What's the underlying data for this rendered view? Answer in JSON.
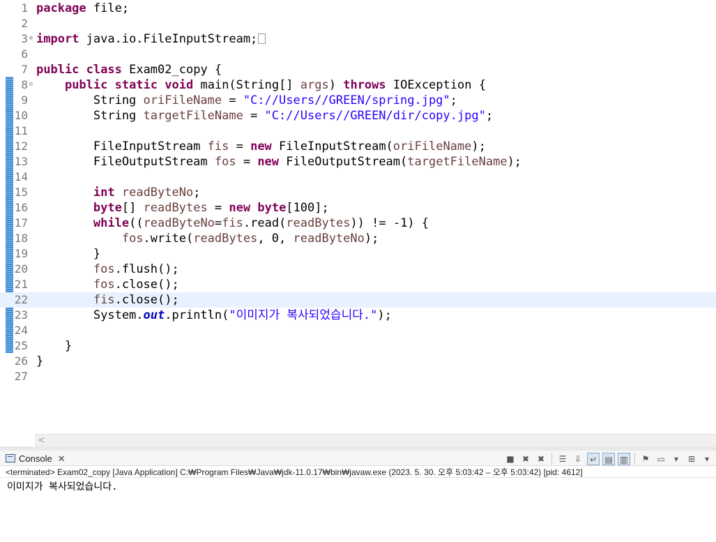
{
  "editor": {
    "file_lines": [
      {
        "n": "1",
        "tokens": [
          {
            "t": "kw",
            "v": "package"
          },
          {
            "t": "",
            "v": " file;"
          }
        ]
      },
      {
        "n": "2",
        "tokens": []
      },
      {
        "n": "3",
        "fold": "plus",
        "tokens": [
          {
            "t": "kw",
            "v": "import"
          },
          {
            "t": "",
            "v": " java.io.FileInputStream;"
          },
          {
            "t": "box",
            "v": ""
          }
        ]
      },
      {
        "n": "6",
        "tokens": []
      },
      {
        "n": "7",
        "tokens": [
          {
            "t": "kw",
            "v": "public"
          },
          {
            "t": "",
            "v": " "
          },
          {
            "t": "kw",
            "v": "class"
          },
          {
            "t": "",
            "v": " Exam02_copy {"
          }
        ]
      },
      {
        "n": "8",
        "fold": "minus",
        "tokens": [
          {
            "t": "",
            "v": "    "
          },
          {
            "t": "kw",
            "v": "public"
          },
          {
            "t": "",
            "v": " "
          },
          {
            "t": "kw",
            "v": "static"
          },
          {
            "t": "",
            "v": " "
          },
          {
            "t": "kw",
            "v": "void"
          },
          {
            "t": "",
            "v": " main(String[] "
          },
          {
            "t": "var",
            "v": "args"
          },
          {
            "t": "",
            "v": ") "
          },
          {
            "t": "kw",
            "v": "throws"
          },
          {
            "t": "",
            "v": " IOException {"
          }
        ]
      },
      {
        "n": "9",
        "tokens": [
          {
            "t": "",
            "v": "        String "
          },
          {
            "t": "var",
            "v": "oriFileName"
          },
          {
            "t": "",
            "v": " = "
          },
          {
            "t": "str",
            "v": "\"C://Users//GREEN/spring.jpg\""
          },
          {
            "t": "",
            "v": ";"
          }
        ]
      },
      {
        "n": "10",
        "tokens": [
          {
            "t": "",
            "v": "        String "
          },
          {
            "t": "var",
            "v": "targetFileName"
          },
          {
            "t": "",
            "v": " = "
          },
          {
            "t": "str",
            "v": "\"C://Users//GREEN/dir/copy.jpg\""
          },
          {
            "t": "",
            "v": ";"
          }
        ]
      },
      {
        "n": "11",
        "tokens": []
      },
      {
        "n": "12",
        "tokens": [
          {
            "t": "",
            "v": "        FileInputStream "
          },
          {
            "t": "var",
            "v": "fis"
          },
          {
            "t": "",
            "v": " = "
          },
          {
            "t": "kw",
            "v": "new"
          },
          {
            "t": "",
            "v": " FileInputStream("
          },
          {
            "t": "var",
            "v": "oriFileName"
          },
          {
            "t": "",
            "v": ");"
          }
        ]
      },
      {
        "n": "13",
        "tokens": [
          {
            "t": "",
            "v": "        FileOutputStream "
          },
          {
            "t": "var",
            "v": "fos"
          },
          {
            "t": "",
            "v": " = "
          },
          {
            "t": "kw",
            "v": "new"
          },
          {
            "t": "",
            "v": " FileOutputStream("
          },
          {
            "t": "var",
            "v": "targetFileName"
          },
          {
            "t": "",
            "v": ");"
          }
        ]
      },
      {
        "n": "14",
        "tokens": []
      },
      {
        "n": "15",
        "tokens": [
          {
            "t": "",
            "v": "        "
          },
          {
            "t": "kw",
            "v": "int"
          },
          {
            "t": "",
            "v": " "
          },
          {
            "t": "var",
            "v": "readByteNo"
          },
          {
            "t": "",
            "v": ";"
          }
        ]
      },
      {
        "n": "16",
        "tokens": [
          {
            "t": "",
            "v": "        "
          },
          {
            "t": "kw",
            "v": "byte"
          },
          {
            "t": "",
            "v": "[] "
          },
          {
            "t": "var",
            "v": "readBytes"
          },
          {
            "t": "",
            "v": " = "
          },
          {
            "t": "kw",
            "v": "new"
          },
          {
            "t": "",
            "v": " "
          },
          {
            "t": "kw",
            "v": "byte"
          },
          {
            "t": "",
            "v": "[100];"
          }
        ]
      },
      {
        "n": "17",
        "tokens": [
          {
            "t": "",
            "v": "        "
          },
          {
            "t": "kw",
            "v": "while"
          },
          {
            "t": "",
            "v": "(("
          },
          {
            "t": "var",
            "v": "readByteNo"
          },
          {
            "t": "",
            "v": "="
          },
          {
            "t": "var",
            "v": "fis"
          },
          {
            "t": "",
            "v": ".read("
          },
          {
            "t": "var",
            "v": "readBytes"
          },
          {
            "t": "",
            "v": ")) != -1) {"
          }
        ]
      },
      {
        "n": "18",
        "tokens": [
          {
            "t": "",
            "v": "            "
          },
          {
            "t": "var",
            "v": "fos"
          },
          {
            "t": "",
            "v": ".write("
          },
          {
            "t": "var",
            "v": "readBytes"
          },
          {
            "t": "",
            "v": ", 0, "
          },
          {
            "t": "var",
            "v": "readByteNo"
          },
          {
            "t": "",
            "v": ");"
          }
        ]
      },
      {
        "n": "19",
        "tokens": [
          {
            "t": "",
            "v": "        }"
          }
        ]
      },
      {
        "n": "20",
        "tokens": [
          {
            "t": "",
            "v": "        "
          },
          {
            "t": "var",
            "v": "fos"
          },
          {
            "t": "",
            "v": ".flush();"
          }
        ]
      },
      {
        "n": "21",
        "tokens": [
          {
            "t": "",
            "v": "        "
          },
          {
            "t": "var",
            "v": "fos"
          },
          {
            "t": "",
            "v": ".close();"
          }
        ]
      },
      {
        "n": "22",
        "current": true,
        "tokens": [
          {
            "t": "",
            "v": "        "
          },
          {
            "t": "var",
            "v": "fis"
          },
          {
            "t": "",
            "v": ".close();"
          }
        ]
      },
      {
        "n": "23",
        "tokens": [
          {
            "t": "",
            "v": "        System."
          },
          {
            "t": "sfield",
            "v": "out"
          },
          {
            "t": "",
            "v": ".println("
          },
          {
            "t": "str",
            "v": "\"이미지가 복사되었습니다.\""
          },
          {
            "t": "",
            "v": ");"
          }
        ]
      },
      {
        "n": "24",
        "tokens": []
      },
      {
        "n": "25",
        "tokens": [
          {
            "t": "",
            "v": "    }"
          }
        ]
      },
      {
        "n": "26",
        "tokens": [
          {
            "t": "",
            "v": "}"
          }
        ]
      },
      {
        "n": "27",
        "tokens": []
      }
    ]
  },
  "console": {
    "tab_label": "Console",
    "tab_close": "✕",
    "status": "<terminated> Exam02_copy [Java Application] C:₩Program Files₩Java₩jdk-11.0.17₩bin₩javaw.exe  (2023. 5. 30. 오후 5:03:42 – 오후 5:03:42) [pid: 4612]",
    "output": "이미지가 복사되었습니다.",
    "toolbar_icons": [
      {
        "name": "terminate-icon",
        "glyph": "■"
      },
      {
        "name": "remove-launch-icon",
        "glyph": "✖"
      },
      {
        "name": "remove-all-terminated-icon",
        "glyph": "✖"
      },
      {
        "sep": true
      },
      {
        "name": "clear-console-icon",
        "glyph": "☰"
      },
      {
        "name": "scroll-lock-icon",
        "glyph": "⇩"
      },
      {
        "name": "word-wrap-icon",
        "glyph": "↵",
        "pressed": true
      },
      {
        "name": "show-on-stdout-icon",
        "glyph": "▤",
        "pressed": true
      },
      {
        "name": "show-on-stderr-icon",
        "glyph": "▥",
        "pressed": true
      },
      {
        "sep": true
      },
      {
        "name": "pin-console-icon",
        "glyph": "⚑"
      },
      {
        "name": "display-console-icon",
        "glyph": "▭"
      },
      {
        "name": "display-console-dropdown-icon",
        "glyph": "▾"
      },
      {
        "name": "open-console-icon",
        "glyph": "⊞"
      },
      {
        "name": "open-console-dropdown-icon",
        "glyph": "▾"
      }
    ]
  },
  "scroll": {
    "left_arrow": "<"
  }
}
